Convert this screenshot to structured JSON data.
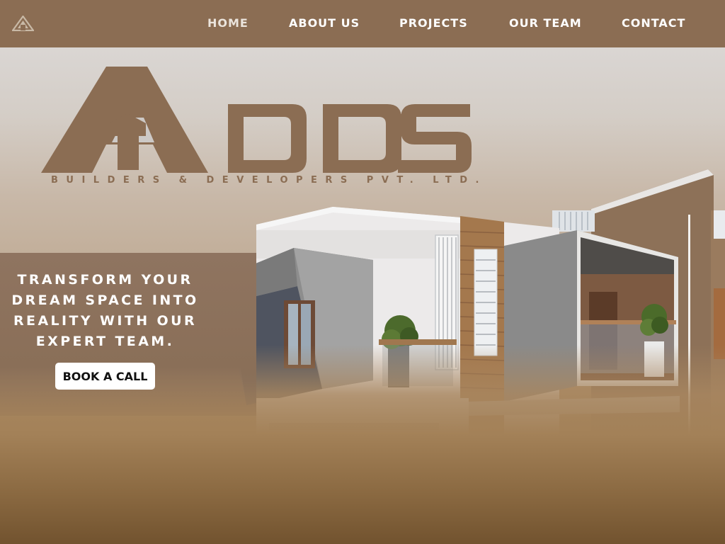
{
  "nav": {
    "links": [
      {
        "label": "HOME"
      },
      {
        "label": "ABOUT US"
      },
      {
        "label": "PROJECTS"
      },
      {
        "label": "OUR TEAM"
      },
      {
        "label": "CONTACT"
      }
    ],
    "active_index": 0,
    "logo_icon": "company-logo-icon"
  },
  "brand": {
    "name": "ADDS",
    "tagline": "BUILDERS & DEVELOPERS PVT. LTD."
  },
  "hero": {
    "headline": "TRANSFORM YOUR DREAM SPACE INTO REALITY WITH OUR EXPERT TEAM.",
    "cta_label": "BOOK A CALL",
    "image": "modern-house-render"
  },
  "colors": {
    "brand_brown": "#8b6d53",
    "panel": "#8a6f58",
    "cta_bg": "#ffffff",
    "cta_text": "#111111"
  }
}
